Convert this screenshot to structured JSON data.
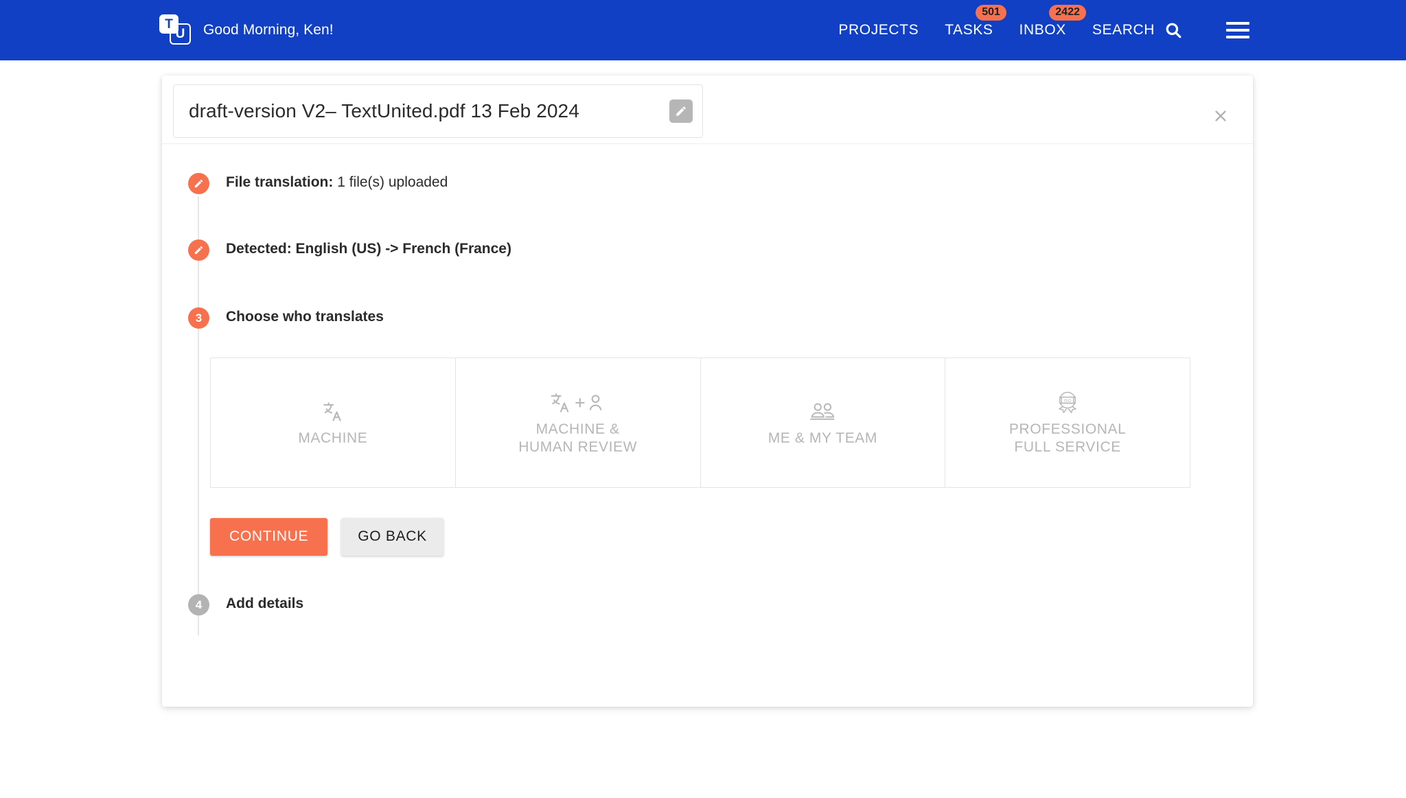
{
  "header": {
    "logo_letters": {
      "first": "T",
      "second": "U"
    },
    "greeting": "Good Morning, Ken!",
    "nav": [
      {
        "label": "PROJECTS",
        "badge": null
      },
      {
        "label": "TASKS",
        "badge": "501"
      },
      {
        "label": "INBOX",
        "badge": "2422"
      }
    ],
    "search_label": "SEARCH",
    "brand_color": "#1140C4",
    "accent_color": "#F8714F"
  },
  "panel": {
    "title": "draft-version V2– TextUnited.pdf 13 Feb 2024",
    "edit_tooltip": "Edit",
    "close_label": "×"
  },
  "steps": [
    {
      "bullet": "pencil",
      "state": "done",
      "label_bold": "File translation:",
      "label_rest": " 1 file(s) uploaded"
    },
    {
      "bullet": "pencil",
      "state": "done",
      "label_bold": "Detected: English (US) -> French (France)",
      "label_rest": ""
    },
    {
      "bullet": "3",
      "state": "active",
      "label_bold": "Choose who translates",
      "label_rest": ""
    },
    {
      "bullet": "4",
      "state": "inactive",
      "label_bold": "Add details",
      "label_rest": ""
    }
  ],
  "options": [
    {
      "icon": "translate-icon",
      "label": "MACHINE"
    },
    {
      "icon": "translate-plus-person-icon",
      "label": "MACHINE &\nHUMAN REVIEW"
    },
    {
      "icon": "people-group-icon",
      "label": "ME & MY TEAM"
    },
    {
      "icon": "iso-badge-icon",
      "label": "PROFESSIONAL\nFULL SERVICE"
    }
  ],
  "actions": {
    "continue_label": "CONTINUE",
    "back_label": "GO BACK"
  }
}
